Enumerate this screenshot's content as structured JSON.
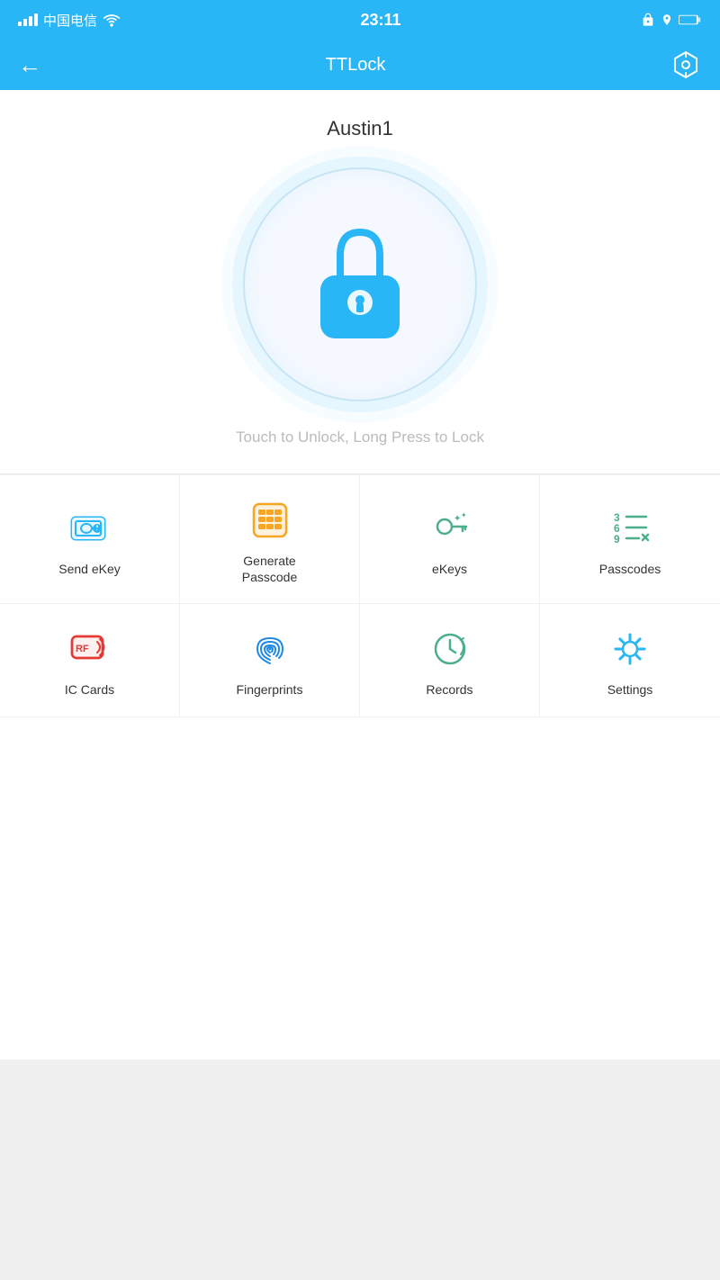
{
  "statusBar": {
    "carrier": "中国电信",
    "time": "23:11",
    "wifiIcon": "wifi",
    "locationIcon": "location",
    "batteryIcon": "battery"
  },
  "header": {
    "title": "TTLock",
    "backLabel": "←",
    "settingsLabel": "⬡"
  },
  "lock": {
    "name": "Austin1",
    "hint": "Touch to Unlock, Long Press to Lock"
  },
  "menu": {
    "row1": [
      {
        "id": "send-ekey",
        "label": "Send eKey",
        "color": "#29b6f6"
      },
      {
        "id": "generate-passcode",
        "label": "Generate\nPasscode",
        "color": "#f5a623"
      },
      {
        "id": "ekeys",
        "label": "eKeys",
        "color": "#4caf8a"
      },
      {
        "id": "passcodes",
        "label": "Passcodes",
        "color": "#4caf8a"
      }
    ],
    "row2": [
      {
        "id": "ic-cards",
        "label": "IC Cards",
        "color": "#e53935"
      },
      {
        "id": "fingerprints",
        "label": "Fingerprints",
        "color": "#1e88e5"
      },
      {
        "id": "records",
        "label": "Records",
        "color": "#4caf8a"
      },
      {
        "id": "settings",
        "label": "Settings",
        "color": "#29b6f6"
      }
    ]
  }
}
